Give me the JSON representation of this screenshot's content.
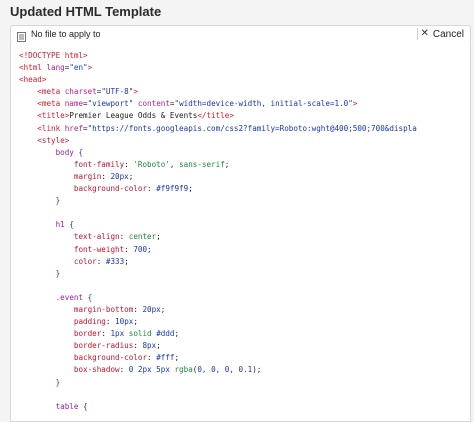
{
  "window": {
    "title": "Updated HTML Template"
  },
  "toolbar": {
    "file_label": "No file to apply to",
    "cancel_label": "Cancel"
  },
  "icons": {
    "file": "document-lines-icon",
    "close": "close-icon"
  },
  "code_lines": [
    [
      [
        "tag",
        "<!DOCTYPE html>"
      ]
    ],
    [
      [
        "tag",
        "<html "
      ],
      [
        "attr",
        "lang"
      ],
      [
        "plain",
        "="
      ],
      [
        "str",
        "\"en\""
      ],
      [
        "tag",
        ">"
      ]
    ],
    [
      [
        "tag",
        "<head>"
      ]
    ],
    [
      [
        "plain",
        "    "
      ],
      [
        "tag",
        "<meta "
      ],
      [
        "attr",
        "charset"
      ],
      [
        "plain",
        "="
      ],
      [
        "str",
        "\"UTF-8\""
      ],
      [
        "tag",
        ">"
      ]
    ],
    [
      [
        "plain",
        "    "
      ],
      [
        "tag",
        "<meta "
      ],
      [
        "attr",
        "name"
      ],
      [
        "plain",
        "="
      ],
      [
        "str",
        "\"viewport\""
      ],
      [
        "plain",
        " "
      ],
      [
        "attr",
        "content"
      ],
      [
        "plain",
        "="
      ],
      [
        "str",
        "\"width=device-width, initial-scale=1.0\""
      ],
      [
        "tag",
        ">"
      ]
    ],
    [
      [
        "plain",
        "    "
      ],
      [
        "tag",
        "<title>"
      ],
      [
        "plain",
        "Premier League Odds & Events"
      ],
      [
        "tag",
        "</title>"
      ]
    ],
    [
      [
        "plain",
        "    "
      ],
      [
        "tag",
        "<link "
      ],
      [
        "attr",
        "href"
      ],
      [
        "plain",
        "="
      ],
      [
        "str",
        "\"https://fonts.googleapis.com/css2?family=Roboto:wght@400;500;700&displa"
      ]
    ],
    [
      [
        "plain",
        "    "
      ],
      [
        "tag",
        "<style>"
      ]
    ],
    [
      [
        "plain",
        "        "
      ],
      [
        "sel",
        "body"
      ],
      [
        "plain",
        " "
      ],
      [
        "brace",
        "{"
      ]
    ],
    [
      [
        "plain",
        "            "
      ],
      [
        "prop",
        "font-family"
      ],
      [
        "plain",
        ": "
      ],
      [
        "val",
        "'Roboto'"
      ],
      [
        "plain",
        ", "
      ],
      [
        "val",
        "sans-serif"
      ],
      [
        "plain",
        ";"
      ]
    ],
    [
      [
        "plain",
        "            "
      ],
      [
        "prop",
        "margin"
      ],
      [
        "plain",
        ": "
      ],
      [
        "num",
        "20px"
      ],
      [
        "plain",
        ";"
      ]
    ],
    [
      [
        "plain",
        "            "
      ],
      [
        "prop",
        "background-color"
      ],
      [
        "plain",
        ": "
      ],
      [
        "num",
        "#f9f9f9"
      ],
      [
        "plain",
        ";"
      ]
    ],
    [
      [
        "plain",
        "        "
      ],
      [
        "brace",
        "}"
      ]
    ],
    [
      [
        "plain",
        ""
      ]
    ],
    [
      [
        "plain",
        "        "
      ],
      [
        "sel",
        "h1"
      ],
      [
        "plain",
        " "
      ],
      [
        "brace",
        "{"
      ]
    ],
    [
      [
        "plain",
        "            "
      ],
      [
        "prop",
        "text-align"
      ],
      [
        "plain",
        ": "
      ],
      [
        "val",
        "center"
      ],
      [
        "plain",
        ";"
      ]
    ],
    [
      [
        "plain",
        "            "
      ],
      [
        "prop",
        "font-weight"
      ],
      [
        "plain",
        ": "
      ],
      [
        "num",
        "700"
      ],
      [
        "plain",
        ";"
      ]
    ],
    [
      [
        "plain",
        "            "
      ],
      [
        "prop",
        "color"
      ],
      [
        "plain",
        ": "
      ],
      [
        "num",
        "#333"
      ],
      [
        "plain",
        ";"
      ]
    ],
    [
      [
        "plain",
        "        "
      ],
      [
        "brace",
        "}"
      ]
    ],
    [
      [
        "plain",
        ""
      ]
    ],
    [
      [
        "plain",
        "        "
      ],
      [
        "sel",
        ".event"
      ],
      [
        "plain",
        " "
      ],
      [
        "brace",
        "{"
      ]
    ],
    [
      [
        "plain",
        "            "
      ],
      [
        "prop",
        "margin-bottom"
      ],
      [
        "plain",
        ": "
      ],
      [
        "num",
        "20px"
      ],
      [
        "plain",
        ";"
      ]
    ],
    [
      [
        "plain",
        "            "
      ],
      [
        "prop",
        "padding"
      ],
      [
        "plain",
        ": "
      ],
      [
        "num",
        "10px"
      ],
      [
        "plain",
        ";"
      ]
    ],
    [
      [
        "plain",
        "            "
      ],
      [
        "prop",
        "border"
      ],
      [
        "plain",
        ": "
      ],
      [
        "num",
        "1px"
      ],
      [
        "plain",
        " "
      ],
      [
        "val",
        "solid"
      ],
      [
        "plain",
        " "
      ],
      [
        "num",
        "#ddd"
      ],
      [
        "plain",
        ";"
      ]
    ],
    [
      [
        "plain",
        "            "
      ],
      [
        "prop",
        "border-radius"
      ],
      [
        "plain",
        ": "
      ],
      [
        "num",
        "8px"
      ],
      [
        "plain",
        ";"
      ]
    ],
    [
      [
        "plain",
        "            "
      ],
      [
        "prop",
        "background-color"
      ],
      [
        "plain",
        ": "
      ],
      [
        "num",
        "#fff"
      ],
      [
        "plain",
        ";"
      ]
    ],
    [
      [
        "plain",
        "            "
      ],
      [
        "prop",
        "box-shadow"
      ],
      [
        "plain",
        ": "
      ],
      [
        "num",
        "0 2px 5px"
      ],
      [
        "plain",
        " "
      ],
      [
        "val",
        "rgba"
      ],
      [
        "plain",
        "("
      ],
      [
        "num",
        "0, 0, 0, 0.1"
      ],
      [
        "plain",
        ");"
      ]
    ],
    [
      [
        "plain",
        "        "
      ],
      [
        "brace",
        "}"
      ]
    ],
    [
      [
        "plain",
        ""
      ]
    ],
    [
      [
        "plain",
        "        "
      ],
      [
        "sel",
        "table"
      ],
      [
        "plain",
        " "
      ],
      [
        "brace",
        "{"
      ]
    ]
  ]
}
